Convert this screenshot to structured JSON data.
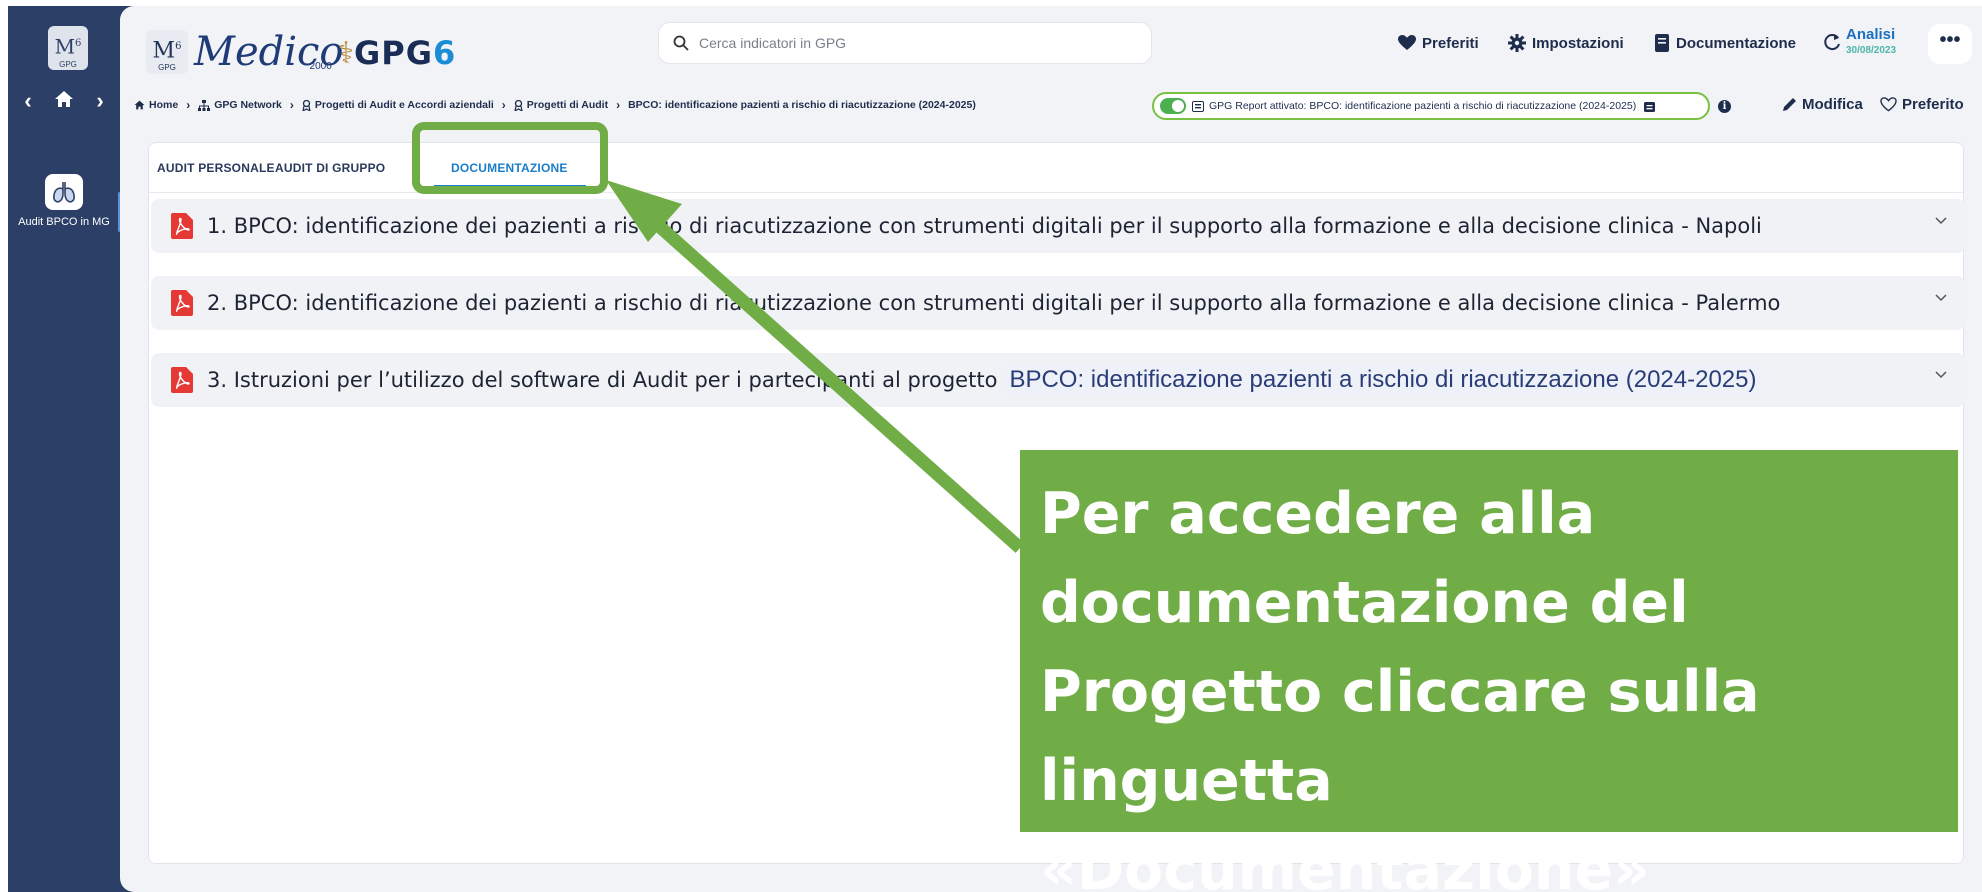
{
  "sidebar": {
    "logo": {
      "mark": "M",
      "sup": "6",
      "sub": "GPG"
    },
    "nav": {
      "back_icon": "chevron-left-icon",
      "home_icon": "home-icon",
      "forward_icon": "chevron-right-icon"
    },
    "items": [
      {
        "label": "Audit BPCO in MG",
        "icon": "lungs-icon"
      }
    ]
  },
  "header": {
    "brand": {
      "m6": "M",
      "m6_sup": "6",
      "m6_sub": "GPG",
      "medico": "Medico",
      "year": "2000",
      "gpg": "GPG",
      "gpg_num": "6"
    },
    "search": {
      "placeholder": "Cerca indicatori in GPG",
      "icon": "search-icon"
    },
    "nav": [
      {
        "label": "Preferiti",
        "icon": "heart-icon"
      },
      {
        "label": "Impostazioni",
        "icon": "gear-icon"
      },
      {
        "label": "Documentazione",
        "icon": "book-icon"
      }
    ],
    "analisi": {
      "label": "Analisi",
      "date": "30/08/2023",
      "icon": "refresh-icon"
    },
    "more_label": "•••"
  },
  "breadcrumb": [
    {
      "label": "Home",
      "icon": "home-icon"
    },
    {
      "label": "GPG Network",
      "icon": "network-icon"
    },
    {
      "label": "Progetti di Audit e Accordi aziendali",
      "icon": "award-icon"
    },
    {
      "label": "Progetti di Audit",
      "icon": "award-icon"
    },
    {
      "label": "BPCO: identificazione pazienti a rischio di riacutizzazione (2024-2025)"
    }
  ],
  "report_badge": {
    "enabled": true,
    "text": "GPG Report attivato: BPCO: identificazione pazienti a rischio di riacutizzazione (2024-2025)"
  },
  "actions": {
    "modifica": "Modifica",
    "preferito": "Preferito"
  },
  "tabs": [
    {
      "label": "AUDIT PERSONALE",
      "active": false
    },
    {
      "label": "AUDIT DI GRUPPO",
      "active": false
    },
    {
      "label": "DOCUMENTAZIONE",
      "active": true
    }
  ],
  "documents": [
    {
      "title": "1. BPCO: identificazione dei pazienti a rischio di riacutizzazione con strumenti digitali per il supporto alla formazione e alla decisione clinica - Napoli",
      "highlight": ""
    },
    {
      "title": "2. BPCO: identificazione dei pazienti a rischio di riacutizzazione con strumenti digitali per il supporto alla formazione e alla decisione clinica - Palermo",
      "highlight": ""
    },
    {
      "title": "3. Istruzioni per l’utilizzo del software di Audit per i partecipanti al progetto",
      "highlight": "BPCO: identificazione pazienti a rischio di riacutizzazione (2024-2025)"
    }
  ],
  "annotation": {
    "text": "Per accedere alla documentazione del Progetto cliccare sulla linguetta «Documentazione»",
    "color": "#70ad47"
  },
  "colors": {
    "sidebar": "#2c3f66",
    "accent": "#1b7dc9",
    "annotation": "#70ad47"
  }
}
